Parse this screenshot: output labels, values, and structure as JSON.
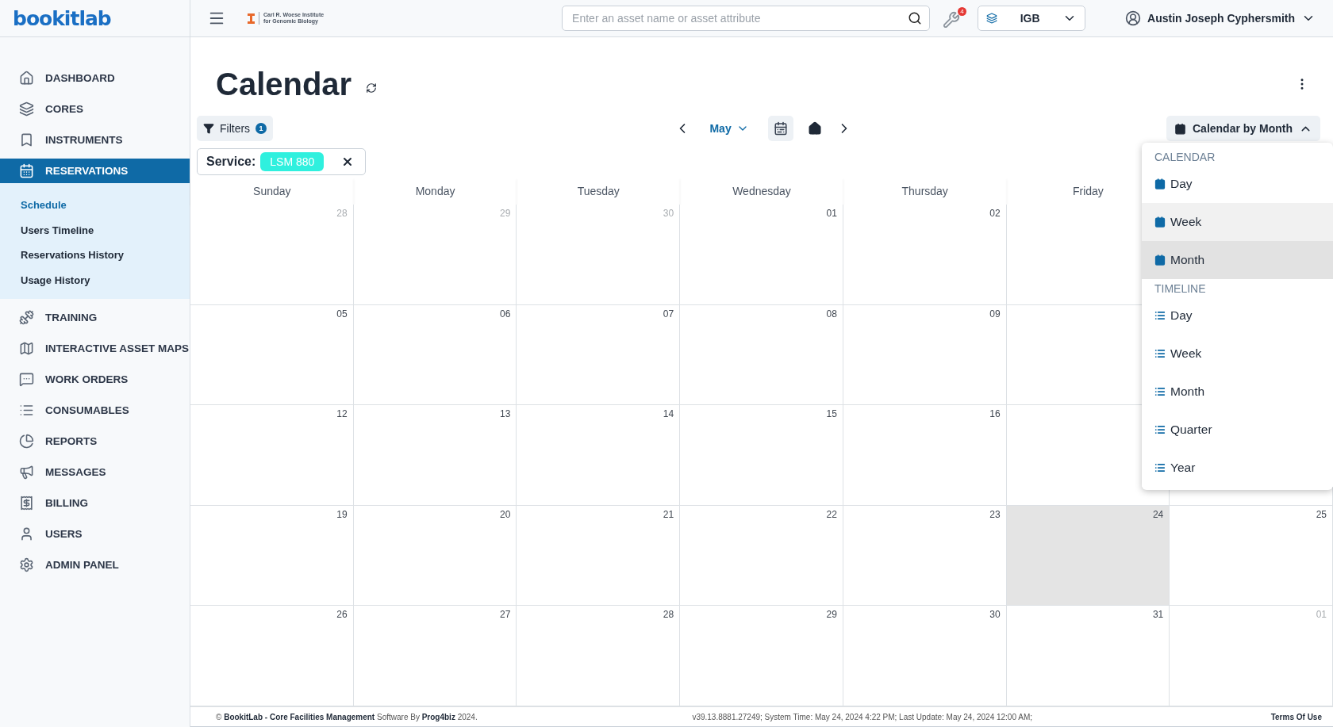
{
  "logo": "bookitlab",
  "institute": {
    "line_1": "Carl R. Woese Institute",
    "line_2": "for Genomic Biology"
  },
  "search": {
    "placeholder": "Enter an asset name or asset attribute"
  },
  "tools_badge": "4",
  "core_select": {
    "value": "IGB"
  },
  "user": {
    "name": "Austin Joseph Cyphersmith"
  },
  "sidebar": {
    "items": [
      {
        "label": "DASHBOARD",
        "selected": false
      },
      {
        "label": "CORES",
        "selected": false
      },
      {
        "label": "INSTRUMENTS",
        "selected": false
      },
      {
        "label": "RESERVATIONS",
        "selected": true,
        "children": [
          {
            "label": "Schedule",
            "selected": true
          },
          {
            "label": "Users Timeline",
            "selected": false
          },
          {
            "label": "Reservations History",
            "selected": false
          },
          {
            "label": "Usage History",
            "selected": false
          }
        ]
      },
      {
        "label": "TRAINING",
        "selected": false
      },
      {
        "label": "INTERACTIVE ASSET MAPS",
        "selected": false
      },
      {
        "label": "WORK ORDERS",
        "selected": false
      },
      {
        "label": "CONSUMABLES",
        "selected": false
      },
      {
        "label": "REPORTS",
        "selected": false
      },
      {
        "label": "MESSAGES",
        "selected": false
      },
      {
        "label": "BILLING",
        "selected": false
      },
      {
        "label": "USERS",
        "selected": false
      },
      {
        "label": "ADMIN PANEL",
        "selected": false
      }
    ]
  },
  "page": {
    "title": "Calendar"
  },
  "filters": {
    "label": "Filters",
    "count": "1"
  },
  "active_filter": {
    "label": "Service:",
    "value": "LSM 880"
  },
  "month_picker": {
    "label": "May"
  },
  "view_button": {
    "label": "Calendar by Month",
    "expanded": true
  },
  "view_menu": {
    "groups": [
      {
        "heading": "CALENDAR",
        "kind": "calendar",
        "items": [
          {
            "label": "Day",
            "selected": false,
            "hovered": false
          },
          {
            "label": "Week",
            "selected": false,
            "hovered": true
          },
          {
            "label": "Month",
            "selected": true,
            "hovered": false
          }
        ]
      },
      {
        "heading": "TIMELINE",
        "kind": "timeline",
        "items": [
          {
            "label": "Day",
            "selected": false,
            "hovered": false
          },
          {
            "label": "Week",
            "selected": false,
            "hovered": false
          },
          {
            "label": "Month",
            "selected": false,
            "hovered": false
          },
          {
            "label": "Quarter",
            "selected": false,
            "hovered": false
          },
          {
            "label": "Year",
            "selected": false,
            "hovered": false
          }
        ]
      }
    ]
  },
  "calendar": {
    "weekdays": [
      "Sunday",
      "Monday",
      "Tuesday",
      "Wednesday",
      "Thursday",
      "Friday"
    ],
    "weeks": [
      [
        {
          "day": "28",
          "other_month": true,
          "today": false
        },
        {
          "day": "29",
          "other_month": true,
          "today": false
        },
        {
          "day": "30",
          "other_month": true,
          "today": false
        },
        {
          "day": "01",
          "other_month": false,
          "today": false
        },
        {
          "day": "02",
          "other_month": false,
          "today": false
        }
      ],
      [
        {
          "day": "05",
          "other_month": false,
          "today": false
        },
        {
          "day": "06",
          "other_month": false,
          "today": false
        },
        {
          "day": "07",
          "other_month": false,
          "today": false
        },
        {
          "day": "08",
          "other_month": false,
          "today": false
        },
        {
          "day": "09",
          "other_month": false,
          "today": false
        }
      ],
      [
        {
          "day": "12",
          "other_month": false,
          "today": false
        },
        {
          "day": "13",
          "other_month": false,
          "today": false
        },
        {
          "day": "14",
          "other_month": false,
          "today": false
        },
        {
          "day": "15",
          "other_month": false,
          "today": false
        },
        {
          "day": "16",
          "other_month": false,
          "today": false
        }
      ],
      [
        {
          "day": "19",
          "other_month": false,
          "today": false
        },
        {
          "day": "20",
          "other_month": false,
          "today": false
        },
        {
          "day": "21",
          "other_month": false,
          "today": false
        },
        {
          "day": "22",
          "other_month": false,
          "today": false
        },
        {
          "day": "23",
          "other_month": false,
          "today": false
        },
        {
          "day": "24",
          "other_month": false,
          "today": true
        },
        {
          "day": "25",
          "other_month": false,
          "today": false
        }
      ],
      [
        {
          "day": "26",
          "other_month": false,
          "today": false
        },
        {
          "day": "27",
          "other_month": false,
          "today": false
        },
        {
          "day": "28",
          "other_month": false,
          "today": false
        },
        {
          "day": "29",
          "other_month": false,
          "today": false
        },
        {
          "day": "30",
          "other_month": false,
          "today": false
        },
        {
          "day": "31",
          "other_month": false,
          "today": false
        },
        {
          "day": "01",
          "other_month": true,
          "today": false
        }
      ]
    ]
  },
  "footer": {
    "copyright": "© **BookitLab - Core Facilities Management** Software By **Prog4biz** 2024.",
    "version": "v39.13.8881.27249; System Time: May 24, 2024 4:22 PM; Last Update: May 24, 2024 12:00 AM;",
    "terms": "Terms Of Use"
  }
}
